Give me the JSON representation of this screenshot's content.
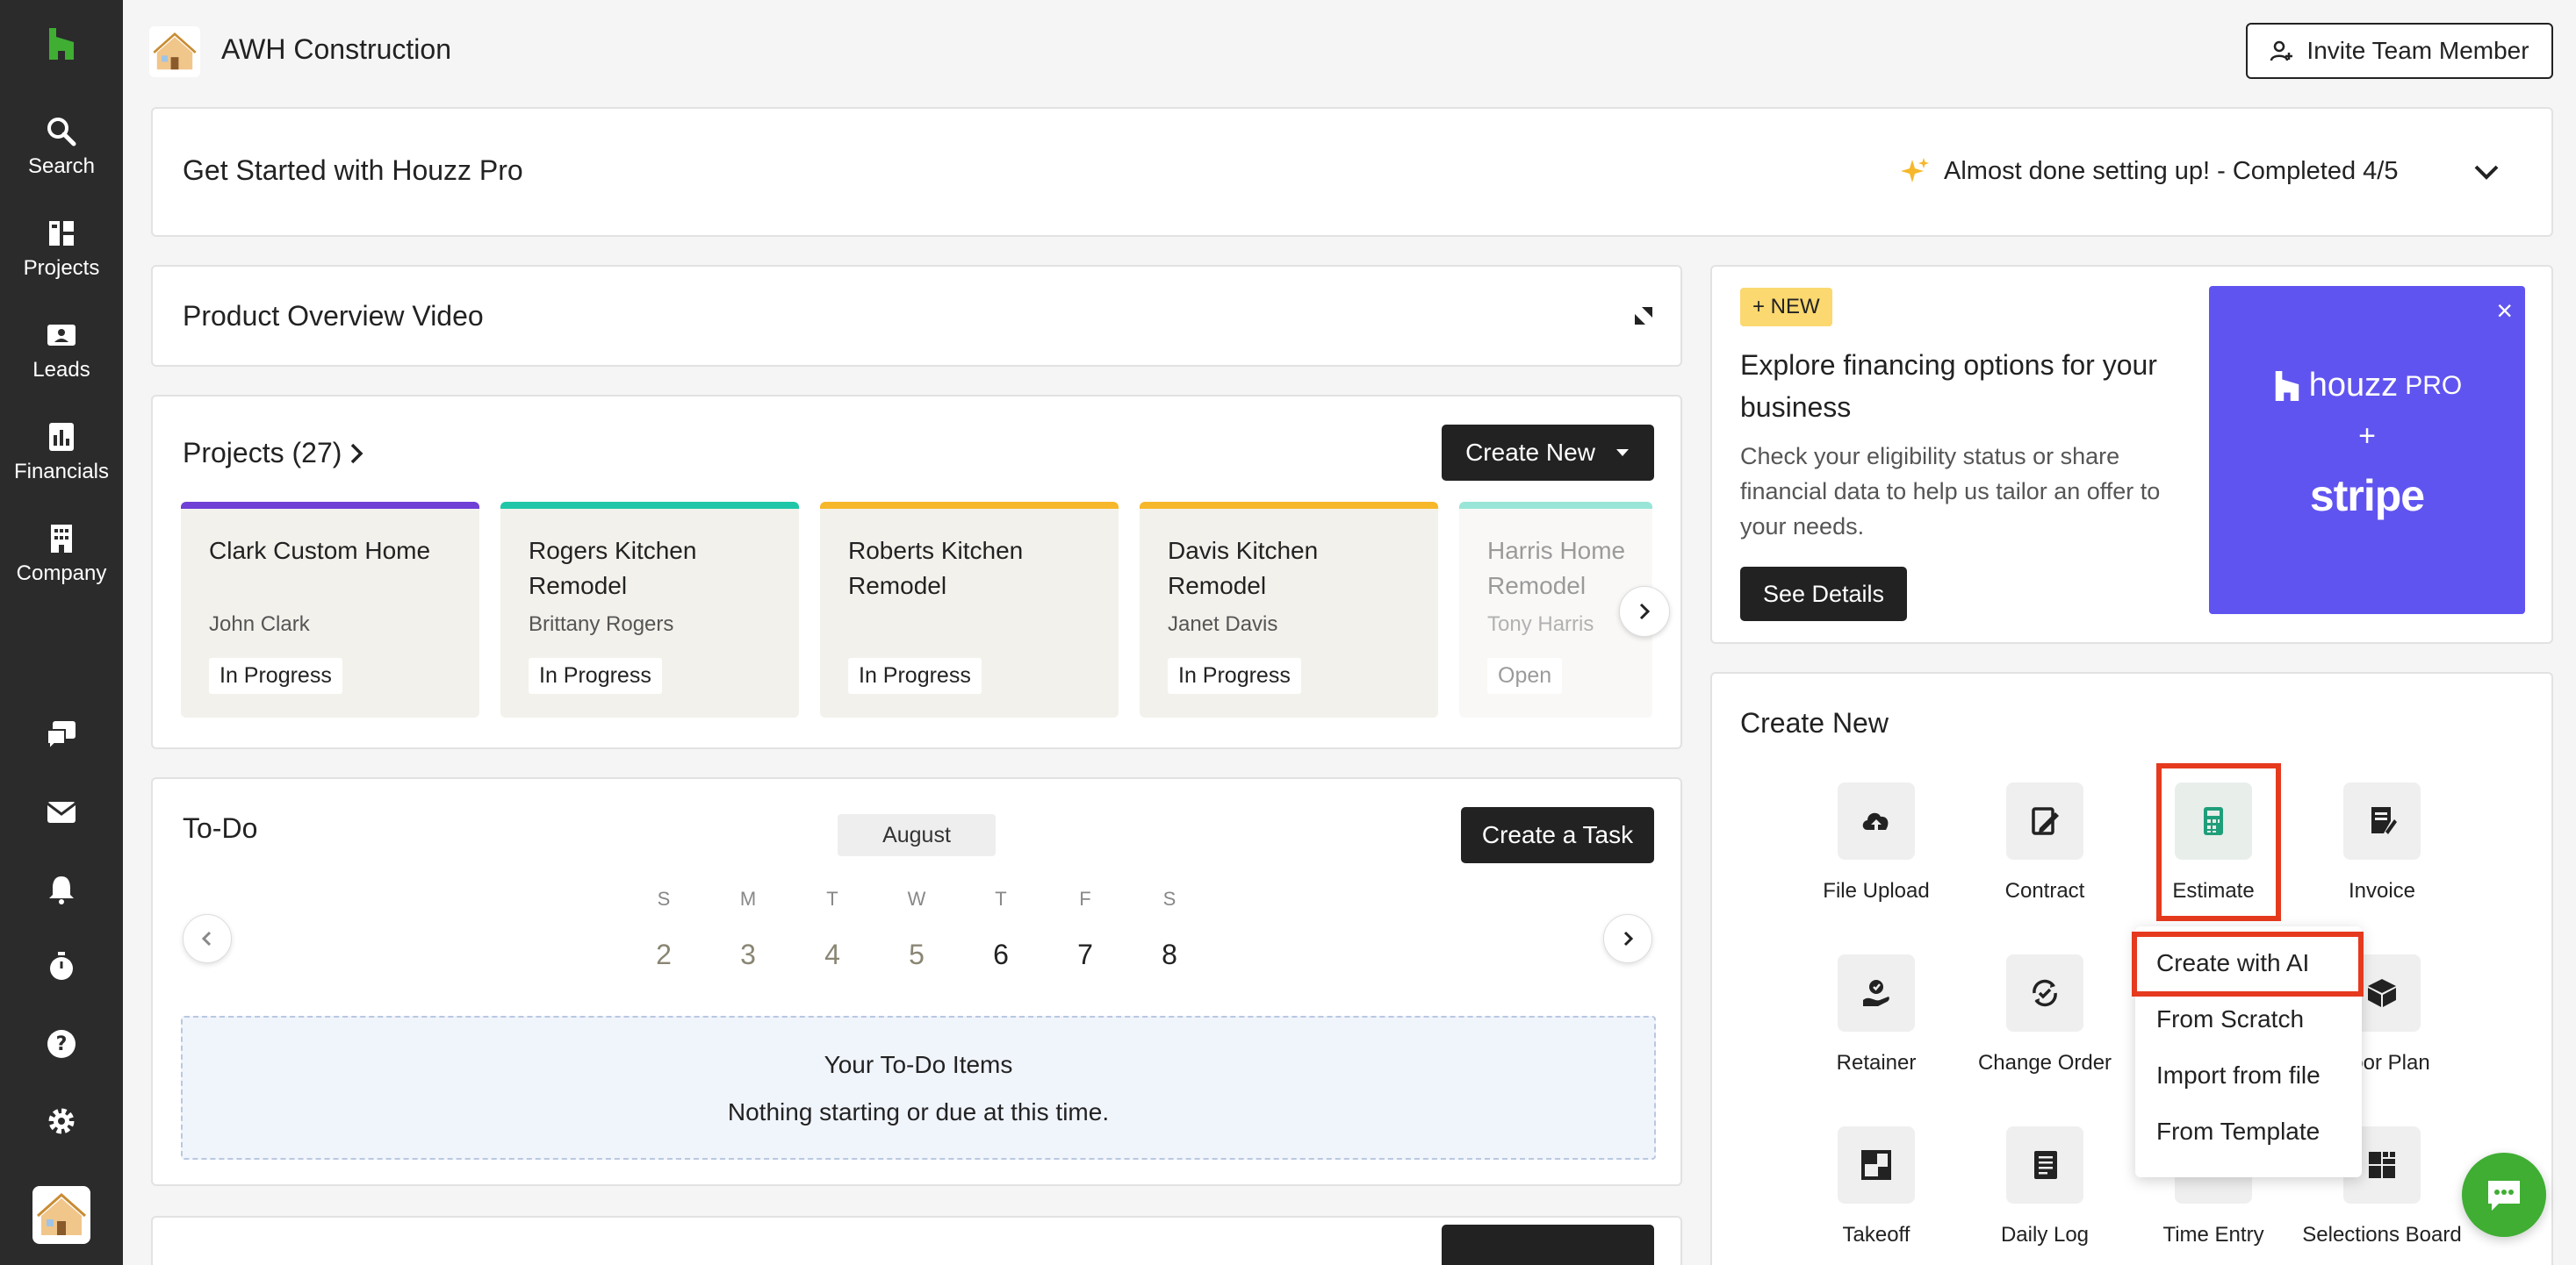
{
  "sidebar": {
    "logo_icon": "houzz-logo-icon",
    "items": [
      {
        "label": "Search",
        "icon": "search-icon"
      },
      {
        "label": "Projects",
        "icon": "projects-icon"
      },
      {
        "label": "Leads",
        "icon": "leads-icon"
      },
      {
        "label": "Financials",
        "icon": "financials-icon"
      },
      {
        "label": "Company",
        "icon": "company-icon"
      }
    ],
    "utility_icons": [
      "messages-icon",
      "mail-icon",
      "bell-icon",
      "timer-icon",
      "help-icon",
      "gear-icon"
    ]
  },
  "header": {
    "company_name": "AWH Construction",
    "invite_label": "Invite Team Member"
  },
  "get_started": {
    "title": "Get Started with Houzz Pro",
    "status": "Almost done setting up! - Completed 4/5"
  },
  "product_overview": {
    "title": "Product Overview Video"
  },
  "projects": {
    "title": "Projects (27)",
    "create_new_label": "Create New",
    "cards": [
      {
        "name": "Clark Custom Home",
        "client": "John Clark",
        "status": "In Progress",
        "color": "#6f3fd6"
      },
      {
        "name": "Rogers Kitchen Remodel",
        "client": "Brittany Rogers",
        "status": "In Progress",
        "color": "#1fc7a8"
      },
      {
        "name": "Roberts Kitchen Remodel",
        "client": "",
        "status": "In Progress",
        "color": "#f6b72b"
      },
      {
        "name": "Davis Kitchen Remodel",
        "client": "Janet Davis",
        "status": "In Progress",
        "color": "#f6b72b"
      },
      {
        "name": "Harris Home Remodel",
        "client": "Tony Harris",
        "status": "Open",
        "color": "#1fc7a8"
      }
    ]
  },
  "todo": {
    "title": "To-Do",
    "month": "August",
    "create_task_label": "Create a Task",
    "days": [
      {
        "letter": "S",
        "num": "2"
      },
      {
        "letter": "M",
        "num": "3"
      },
      {
        "letter": "T",
        "num": "4"
      },
      {
        "letter": "W",
        "num": "5"
      },
      {
        "letter": "T",
        "num": "6"
      },
      {
        "letter": "F",
        "num": "7"
      },
      {
        "letter": "S",
        "num": "8"
      }
    ],
    "empty_title": "Your To-Do Items",
    "empty_text": "Nothing starting or due at this time."
  },
  "promo": {
    "badge": "+ NEW",
    "title": "Explore financing options for your business",
    "body": "Check your eligibility status or share financial data to help us tailor an offer to your needs.",
    "button": "See Details",
    "art_houzz": "houzz",
    "art_pro": "PRO",
    "art_plus": "+",
    "art_stripe": "stripe",
    "close": "×"
  },
  "create_new": {
    "title": "Create New",
    "tiles": [
      {
        "label": "File Upload",
        "icon": "upload-icon"
      },
      {
        "label": "Contract",
        "icon": "contract-icon"
      },
      {
        "label": "Estimate",
        "icon": "calculator-icon"
      },
      {
        "label": "Invoice",
        "icon": "invoice-icon"
      },
      {
        "label": "Retainer",
        "icon": "retainer-icon"
      },
      {
        "label": "Change Order",
        "icon": "change-order-icon"
      },
      {
        "label": "Floor Plan",
        "icon": "floor-plan-icon"
      },
      {
        "label": "Takeoff",
        "icon": "takeoff-icon"
      },
      {
        "label": "Daily Log",
        "icon": "daily-log-icon"
      },
      {
        "label": "Time Entry",
        "icon": "time-entry-icon"
      },
      {
        "label": "Selections Board",
        "icon": "selections-board-icon"
      }
    ],
    "estimate_menu": [
      "Create with AI",
      "From Scratch",
      "Import from file",
      "From Template"
    ]
  },
  "colors": {
    "sidebar": "#2b2b2b",
    "brand_green": "#3fae33",
    "highlight": "#e53a1e",
    "promo_purple": "#6054f0"
  }
}
